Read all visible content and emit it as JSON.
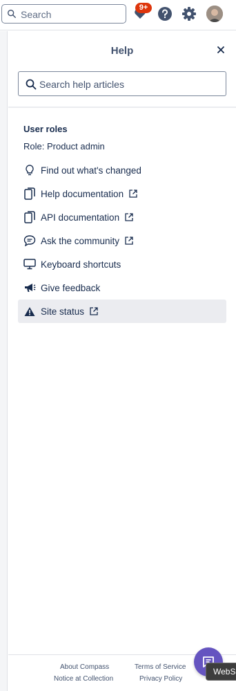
{
  "topbar": {
    "search_placeholder": "Search",
    "notification_badge": "9+"
  },
  "help_panel": {
    "title": "Help",
    "search_placeholder": "Search help articles",
    "user_roles_heading": "User roles",
    "role_text": "Role: Product admin",
    "items": [
      {
        "label": "Find out what's changed",
        "icon": "lightbulb-icon",
        "external": false
      },
      {
        "label": "Help documentation",
        "icon": "document-icon",
        "external": true
      },
      {
        "label": "API documentation",
        "icon": "document-icon",
        "external": true
      },
      {
        "label": "Ask the community",
        "icon": "chat-bubble-icon",
        "external": true
      },
      {
        "label": "Keyboard shortcuts",
        "icon": "monitor-icon",
        "external": false
      },
      {
        "label": "Give feedback",
        "icon": "megaphone-icon",
        "external": false
      },
      {
        "label": "Site status",
        "icon": "warning-icon",
        "external": true
      }
    ],
    "selected_item": "Site status"
  },
  "footer": {
    "about": "About Compass",
    "terms": "Terms of Service",
    "notice": "Notice at Collection",
    "privacy": "Privacy Policy"
  },
  "tooltip_text": "WebS",
  "colors": {
    "accent_purple": "#6554c0",
    "badge_red": "#de350b",
    "text_dark": "#172b4d",
    "hover_bg": "#ebecf0"
  }
}
